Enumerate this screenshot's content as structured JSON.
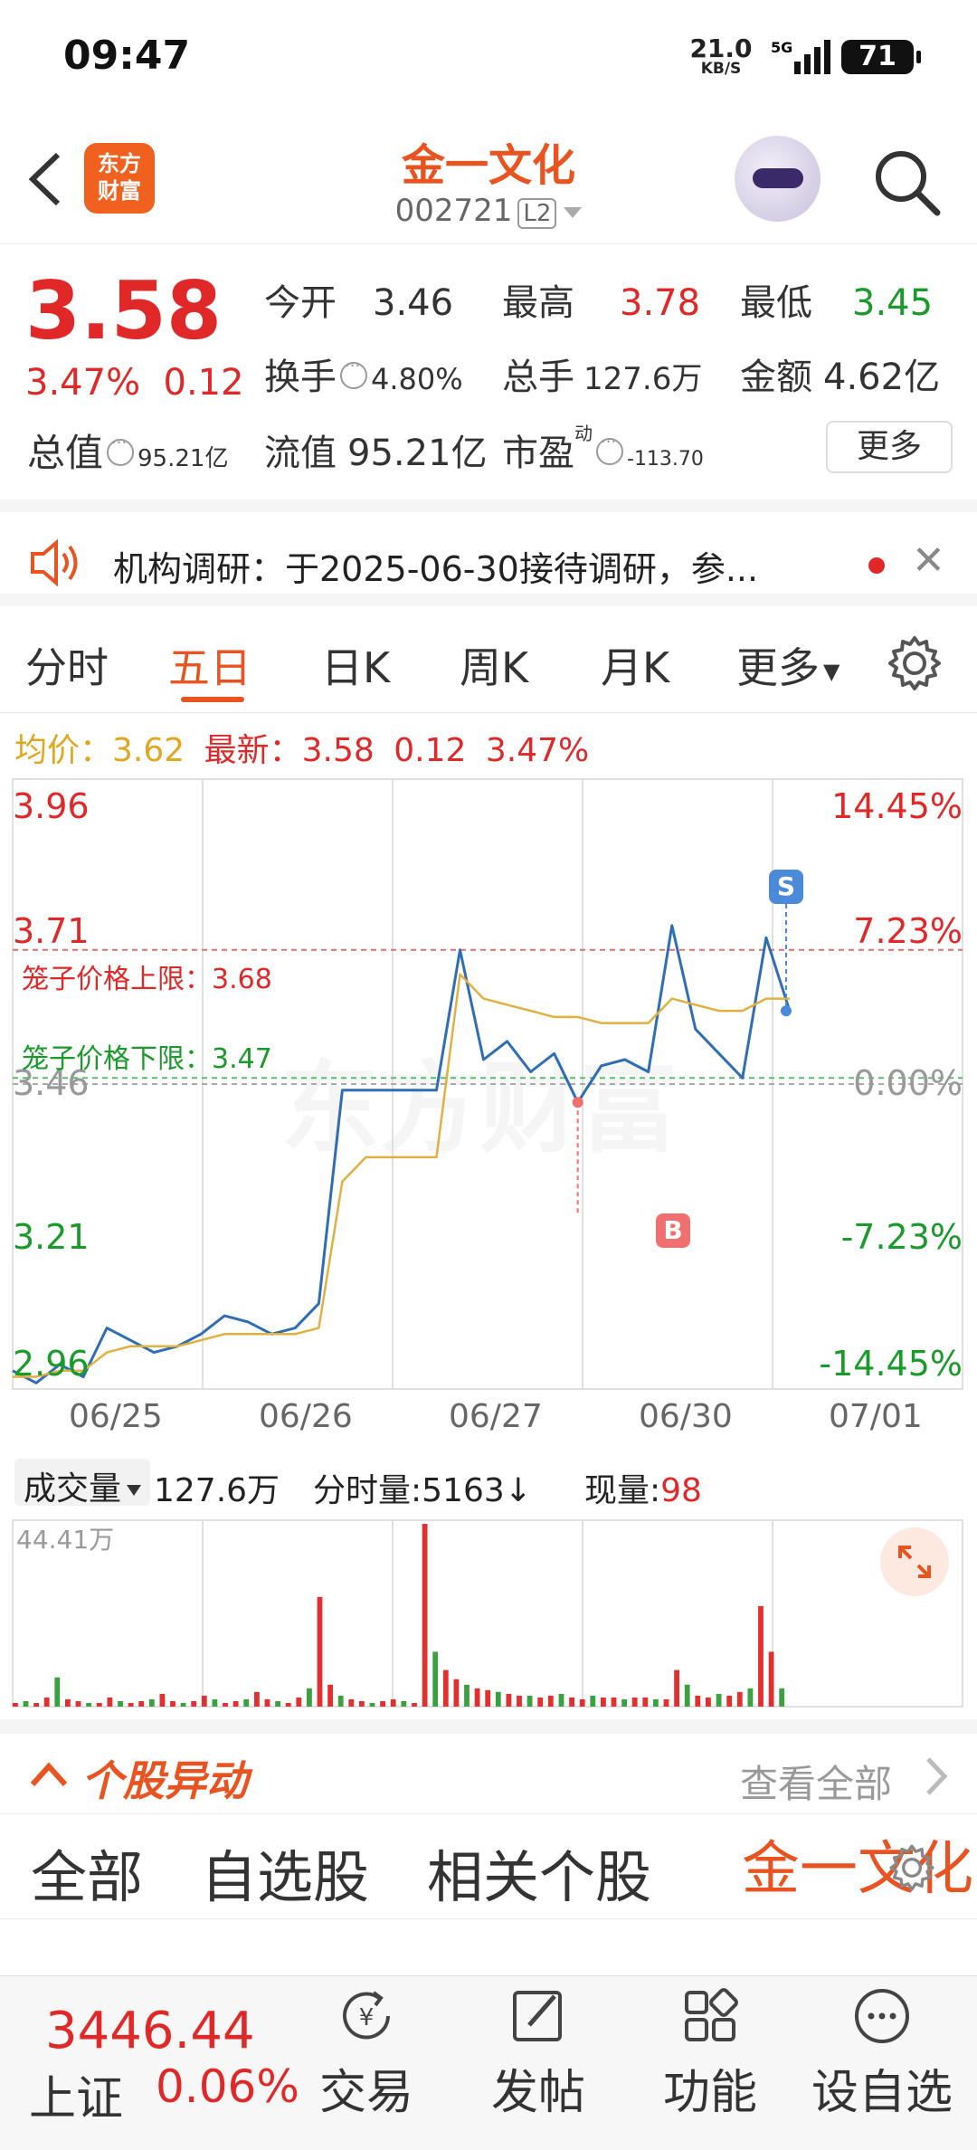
{
  "status_bar": {
    "time": "09:47",
    "speed": "21.0",
    "speed_unit": "KB/S",
    "network": "5G",
    "battery": "71"
  },
  "header": {
    "logo_text_1": "东方",
    "logo_text_2": "财富",
    "stock_name": "金一文化",
    "stock_code": "002721",
    "level_badge": "L2"
  },
  "quote": {
    "price": "3.58",
    "change_pct": "3.47%",
    "change": "0.12",
    "open_label": "今开",
    "open": "3.46",
    "high_label": "最高",
    "high": "3.78",
    "low_label": "最低",
    "low": "3.45",
    "turnover_label": "换手",
    "turnover": "4.80%",
    "volume_label": "总手",
    "volume": "127.6万",
    "amount_label": "金额",
    "amount": "4.62亿",
    "mcap_label": "总值",
    "mcap": "95.21亿",
    "float_label": "流值",
    "float_cap": "95.21亿",
    "pe_label": "市盈",
    "pe_sup": "动",
    "pe": "-113.70",
    "more": "更多"
  },
  "notice": {
    "text": "机构调研：于2025-06-30接待调研，参..."
  },
  "tabs": [
    "分时",
    "五日",
    "日K",
    "周K",
    "月K",
    "更多"
  ],
  "active_tab": "五日",
  "avg_bar": {
    "avg_label": "均价：",
    "avg": "3.62",
    "latest_label": "最新：",
    "latest": "3.58",
    "change": "0.12",
    "change_pct": "3.47%"
  },
  "chart_data": {
    "type": "line",
    "x": [
      "06/25",
      "06/26",
      "06/27",
      "06/30",
      "07/01"
    ],
    "y_left_ticks": [
      "3.96",
      "3.71",
      "3.46",
      "3.21",
      "2.96"
    ],
    "y_right_ticks": [
      "14.45%",
      "7.23%",
      "0.00%",
      "-7.23%",
      "-14.45%"
    ],
    "ylim": [
      2.96,
      3.96
    ],
    "cage_upper": {
      "label": "笼子价格上限：",
      "value": "3.68"
    },
    "cage_lower": {
      "label": "笼子价格下限：",
      "value": "3.47"
    },
    "markers": [
      "S",
      "B"
    ],
    "watermark": "东方财富",
    "series": [
      {
        "color": "#2f6db5",
        "values": [
          2.99,
          2.97,
          3.0,
          2.98,
          3.06,
          3.04,
          3.02,
          3.03,
          3.05,
          3.08,
          3.07,
          3.05,
          3.06,
          3.1,
          3.45,
          3.45,
          3.45,
          3.45,
          3.45,
          3.68,
          3.5,
          3.53,
          3.48,
          3.51,
          3.43,
          3.49,
          3.5,
          3.48,
          3.72,
          3.55,
          3.51,
          3.47,
          3.7,
          3.58
        ]
      },
      {
        "color": "#e0b040",
        "values": [
          2.98,
          2.98,
          2.99,
          2.99,
          3.02,
          3.03,
          3.03,
          3.03,
          3.04,
          3.05,
          3.05,
          3.05,
          3.05,
          3.06,
          3.3,
          3.34,
          3.34,
          3.34,
          3.34,
          3.64,
          3.6,
          3.59,
          3.58,
          3.57,
          3.57,
          3.56,
          3.56,
          3.56,
          3.6,
          3.59,
          3.58,
          3.58,
          3.6,
          3.6
        ]
      }
    ]
  },
  "volume": {
    "selector": "成交量",
    "total": "127.6万",
    "per_tick_label": "分时量:",
    "per_tick": "5163",
    "current_label": "现量:",
    "current": "98",
    "max_label": "44.41万",
    "bars": [
      0.02,
      0.03,
      0.02,
      0.05,
      0.16,
      0.04,
      0.03,
      0.02,
      0.02,
      0.05,
      0.03,
      0.02,
      0.03,
      0.04,
      0.07,
      0.03,
      0.02,
      0.03,
      0.06,
      0.04,
      0.02,
      0.03,
      0.04,
      0.08,
      0.04,
      0.03,
      0.02,
      0.05,
      0.1,
      0.6,
      0.12,
      0.06,
      0.04,
      0.03,
      0.02,
      0.03,
      0.04,
      0.03,
      0.02,
      1.0,
      0.3,
      0.2,
      0.15,
      0.12,
      0.1,
      0.09,
      0.08,
      0.07,
      0.06,
      0.06,
      0.05,
      0.06,
      0.07,
      0.05,
      0.04,
      0.06,
      0.05,
      0.05,
      0.04,
      0.05,
      0.05,
      0.04,
      0.04,
      0.2,
      0.12,
      0.06,
      0.05,
      0.07,
      0.06,
      0.08,
      0.1,
      0.55,
      0.3,
      0.1
    ]
  },
  "moves": {
    "title": "个股异动",
    "view_all": "查看全部"
  },
  "filters": [
    "全部",
    "自选股",
    "相关个股",
    "金一文化"
  ],
  "bottom": {
    "index_value": "3446.44",
    "index_name": "上证",
    "index_change": "0.06%",
    "nav": [
      "交易",
      "发帖",
      "功能",
      "设自选"
    ]
  }
}
